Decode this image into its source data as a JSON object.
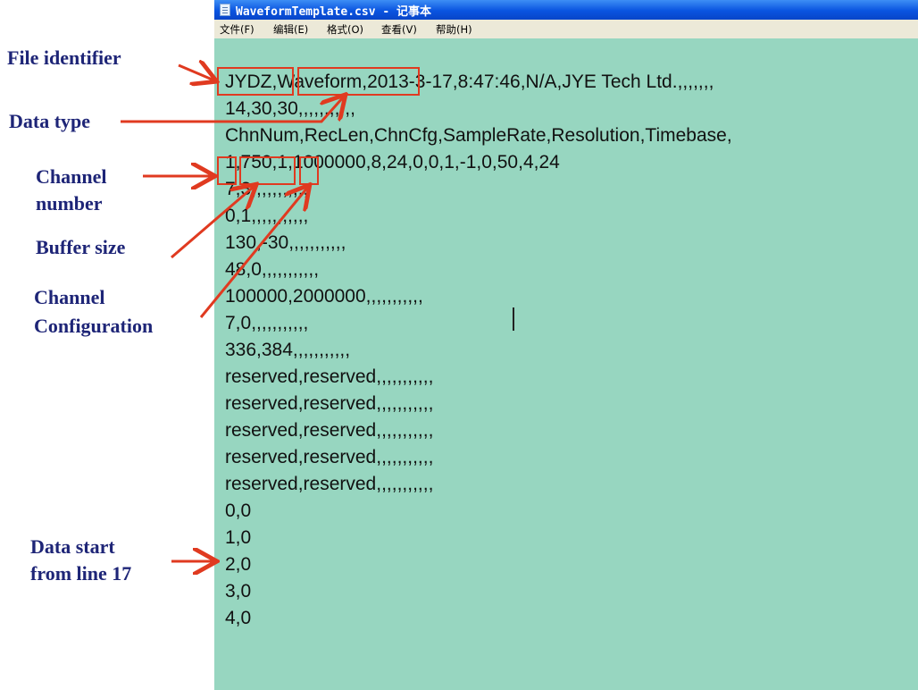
{
  "window": {
    "title": "WaveformTemplate.csv - 记事本",
    "menu": [
      "文件(F)",
      "编辑(E)",
      "格式(O)",
      "查看(V)",
      "帮助(H)"
    ]
  },
  "lines": [
    "JYDZ,Waveform,2013-3-17,8:47:46,N/A,JYE Tech Ltd.,,,,,,,",
    "14,30,30,,,,,,,,,,,",
    "ChnNum,RecLen,ChnCfg,SampleRate,Resolution,Timebase,",
    "1,750,1,1000000,8,24,0,0,1,-1,0,50,4,24",
    "7,3,,,,,,,,,,,",
    "0,1,,,,,,,,,,,",
    "130,-30,,,,,,,,,,,",
    "48,0,,,,,,,,,,,",
    "100000,2000000,,,,,,,,,,,",
    "7,0,,,,,,,,,,,",
    "336,384,,,,,,,,,,,",
    "reserved,reserved,,,,,,,,,,,",
    "reserved,reserved,,,,,,,,,,,",
    "reserved,reserved,,,,,,,,,,,",
    "reserved,reserved,,,,,,,,,,,",
    "reserved,reserved,,,,,,,,,,,",
    "0,0",
    "1,0",
    "2,0",
    "3,0",
    "4,0"
  ],
  "annotations": {
    "file_identifier": "File identifier",
    "data_type": "Data type",
    "channel_number_1": "Channel",
    "channel_number_2": "number",
    "buffer_size": "Buffer size",
    "channel_config_1": "Channel",
    "channel_config_2": "Configuration",
    "data_start_1": "Data start",
    "data_start_2": "from line 17"
  },
  "colors": {
    "annotation_text": "#1e2577",
    "arrow": "#e03a20",
    "editor_background": "#97d6c0",
    "titlebar": "#0a54e0"
  }
}
